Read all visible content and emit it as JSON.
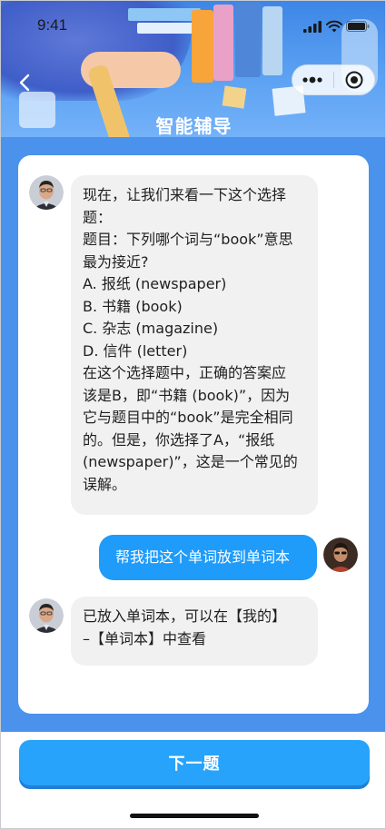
{
  "status_bar": {
    "time": "9:41"
  },
  "header": {
    "title": "智能辅导"
  },
  "chat": {
    "messages": [
      {
        "role": "tutor",
        "lines": [
          "现在，让我们来看一下这个选择",
          "题：",
          "题目：下列哪个词与“book”意思",
          "最为接近?",
          "A. 报纸 (newspaper)",
          "B. 书籍 (book)",
          "C. 杂志 (magazine)",
          "D. 信件 (letter)",
          "在这个选择题中，正确的答案应",
          "该是B，即“书籍 (book)”，因为",
          "它与题目中的“book”是完全相同",
          "的。但是，你选择了A，“报纸",
          "(newspaper)”，这是一个常见的",
          "误解。"
        ]
      },
      {
        "role": "user",
        "text": "帮我把这个单词放到单词本"
      },
      {
        "role": "tutor",
        "lines": [
          "已放入单词本，可以在【我的】",
          "–【单词本】中查看"
        ]
      }
    ]
  },
  "footer": {
    "next_label": "下一题"
  },
  "colors": {
    "header_blue": "#3e86e6",
    "chat_bg_blue": "#4a92ec",
    "user_bubble": "#1f9bfa",
    "tutor_bubble": "#f1f1f2",
    "next_button": "#27a3fb"
  },
  "icons": {
    "back": "chevron-left-icon",
    "more": "more-dots-icon",
    "close": "target-circle-icon",
    "signal": "cellular-signal-icon",
    "wifi": "wifi-icon",
    "battery": "battery-icon"
  }
}
